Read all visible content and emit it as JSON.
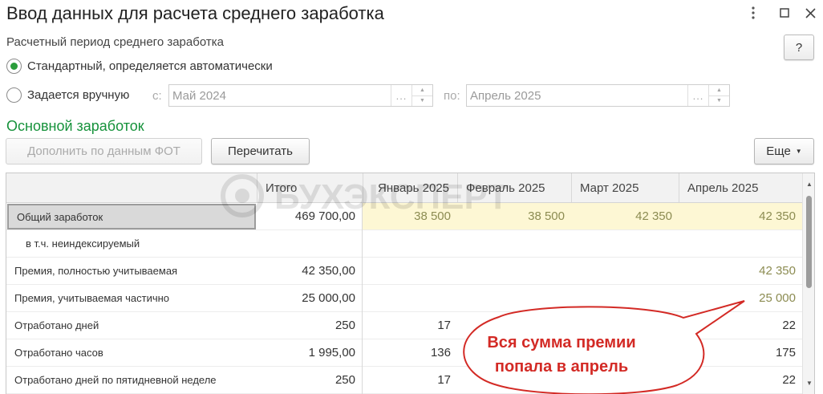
{
  "window": {
    "title": "Ввод данных для расчета среднего заработка",
    "menu_icon": "more-vertical-icon",
    "maximize_icon": "maximize-icon",
    "close_icon": "close-icon"
  },
  "period": {
    "label": "Расчетный период среднего заработка",
    "help_label": "?",
    "radio_auto": {
      "label": "Стандартный, определяется автоматически",
      "checked": true
    },
    "radio_manual": {
      "label": "Задается вручную",
      "checked": false
    },
    "from_label": "с:",
    "from_value": "Май 2024",
    "to_label": "по:",
    "to_value": "Апрель 2025",
    "picker_dots": "..."
  },
  "section": {
    "heading": "Основной заработок",
    "fill_button": "Дополнить по данным ФОТ",
    "recalc_button": "Перечитать",
    "more_button": "Еще",
    "more_icon": "caret-down-icon"
  },
  "table": {
    "columns": [
      "",
      "Итого",
      "Январь 2025",
      "Февраль 2025",
      "Март 2025",
      "Апрель 2025"
    ],
    "rows": [
      {
        "label": "Общий заработок",
        "total": "469 700,00",
        "jan": "38 500",
        "feb": "38 500",
        "mar": "42 350",
        "apr": "42 350"
      },
      {
        "label": "в т.ч. неиндексируемый",
        "total": "",
        "jan": "",
        "feb": "",
        "mar": "",
        "apr": ""
      },
      {
        "label": "Премия, полностью учитываемая",
        "total": "42 350,00",
        "jan": "",
        "feb": "",
        "mar": "",
        "apr": "42 350"
      },
      {
        "label": "Премия, учитываемая частично",
        "total": "25 000,00",
        "jan": "",
        "feb": "",
        "mar": "",
        "apr": "25 000"
      },
      {
        "label": "Отработано дней",
        "total": "250",
        "jan": "17",
        "feb": "",
        "mar": "",
        "apr": "22"
      },
      {
        "label": "Отработано часов",
        "total": "1 995,00",
        "jan": "136",
        "feb": "",
        "mar": "",
        "apr": "175"
      },
      {
        "label": "Отработано дней по пятидневной неделе",
        "total": "250",
        "jan": "17",
        "feb": "",
        "mar": "",
        "apr": "22"
      }
    ]
  },
  "watermark": {
    "text": "БУХЭКСПЕРТ"
  },
  "callout": {
    "line1": "Вся сумма премии",
    "line2": "попала в апрель",
    "color": "#d32a25"
  }
}
